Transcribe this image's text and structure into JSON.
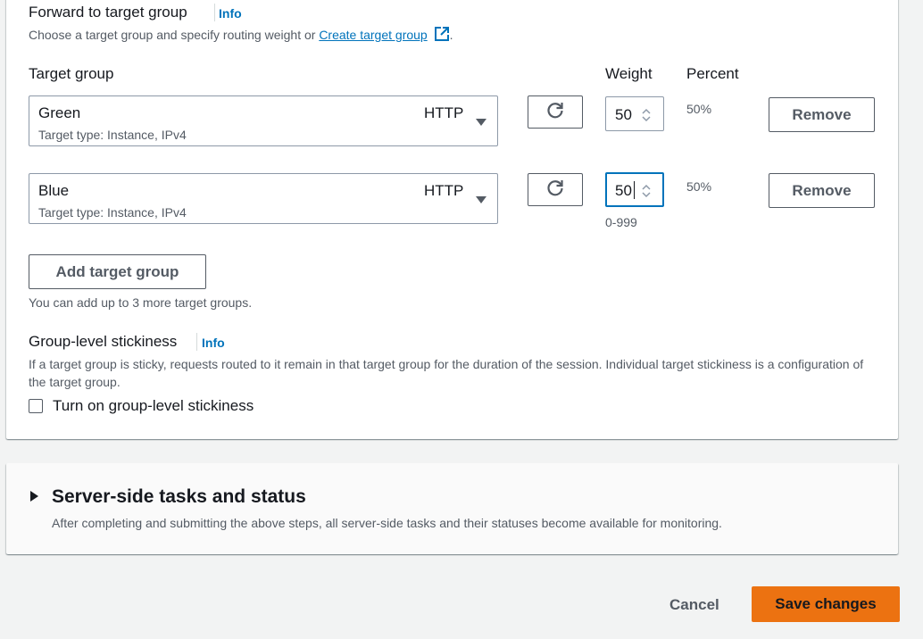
{
  "forward": {
    "title": "Forward to target group",
    "info_label": "Info",
    "description_prefix": "Choose a target group and specify routing weight or ",
    "create_link": "Create target group",
    "description_suffix": "."
  },
  "columns": {
    "target_group": "Target group",
    "weight": "Weight",
    "percent": "Percent"
  },
  "rows": [
    {
      "name": "Green",
      "protocol": "HTTP",
      "subtitle": "Target type: Instance, IPv4",
      "weight": "50",
      "percent": "50%",
      "remove_label": "Remove"
    },
    {
      "name": "Blue",
      "protocol": "HTTP",
      "subtitle": "Target type: Instance, IPv4",
      "weight": "50",
      "percent": "50%",
      "remove_label": "Remove",
      "weight_hint": "0-999"
    }
  ],
  "add_target_group": {
    "label": "Add target group",
    "hint": "You can add up to 3 more target groups."
  },
  "stickiness": {
    "title": "Group-level stickiness",
    "info_label": "Info",
    "description": "If a target group is sticky, requests routed to it remain in that target group for the duration of the session. Individual target stickiness is a configuration of the target group.",
    "checkbox_label": "Turn on group-level stickiness",
    "checked": false
  },
  "server_tasks": {
    "title": "Server-side tasks and status",
    "description": "After completing and submitting the above steps, all server-side tasks and their statuses become available for monitoring."
  },
  "footer": {
    "cancel_label": "Cancel",
    "save_label": "Save changes"
  },
  "colors": {
    "accent": "#0073bb",
    "primary_button": "#ec7211",
    "border": "#8d99a8"
  }
}
